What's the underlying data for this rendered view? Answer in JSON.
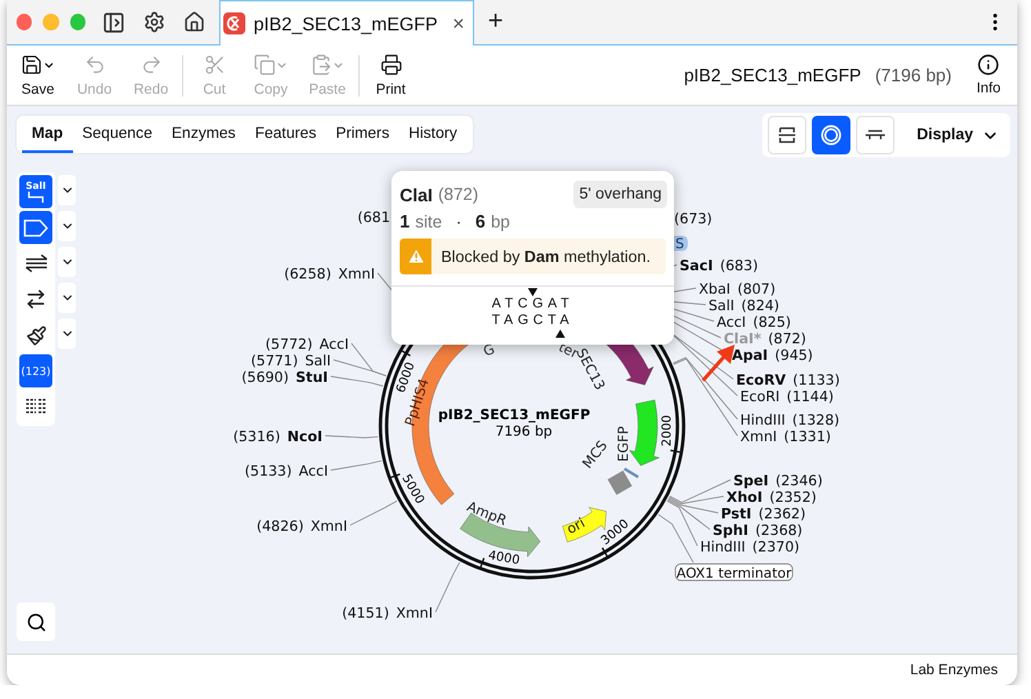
{
  "window": {
    "tab_title": "pIB2_SEC13_mEGFP",
    "close": "×",
    "new_tab": "+"
  },
  "toolbar": {
    "groups": [
      [
        {
          "kind": "save",
          "label": "Save",
          "disabled": false,
          "menu": true
        },
        {
          "kind": "undo",
          "label": "Undo",
          "disabled": true,
          "menu": false
        },
        {
          "kind": "redo",
          "label": "Redo",
          "disabled": true,
          "menu": false
        }
      ],
      [
        {
          "kind": "cut",
          "label": "Cut",
          "disabled": true,
          "menu": false
        },
        {
          "kind": "copy",
          "label": "Copy",
          "disabled": true,
          "menu": true
        },
        {
          "kind": "paste",
          "label": "Paste",
          "disabled": true,
          "menu": true
        }
      ],
      [
        {
          "kind": "print",
          "label": "Print",
          "disabled": false,
          "menu": false
        }
      ]
    ],
    "document": {
      "name": "pIB2_SEC13_mEGFP",
      "size": "(7196 bp)"
    },
    "info": "Info"
  },
  "view_tabs": [
    {
      "label": "Map",
      "selected": true
    },
    {
      "label": "Sequence",
      "selected": false
    },
    {
      "label": "Enzymes",
      "selected": false
    },
    {
      "label": "Features",
      "selected": false
    },
    {
      "label": "Primers",
      "selected": false
    },
    {
      "label": "History",
      "selected": false
    }
  ],
  "display": {
    "views": [
      {
        "kind": "linear",
        "selected": false
      },
      {
        "kind": "circular",
        "selected": true
      },
      {
        "kind": "sequence",
        "selected": false
      }
    ],
    "label": "Display"
  },
  "tools": [
    {
      "kind": "sites",
      "text": "SalI",
      "selected": true,
      "dropdown": true
    },
    {
      "kind": "features",
      "selected": true,
      "dropdown": true
    },
    {
      "kind": "strands",
      "selected": false,
      "dropdown": true
    },
    {
      "kind": "directions",
      "selected": false,
      "dropdown": true
    },
    {
      "kind": "colors",
      "selected": false,
      "dropdown": true
    },
    {
      "kind": "numbers",
      "text": "(123)",
      "selected": true,
      "dropdown": false
    },
    {
      "kind": "list",
      "selected": false,
      "dropdown": false
    }
  ],
  "map": {
    "name": "pIB2_SEC13_mEGFP",
    "length": "7196 bp",
    "ticks": [
      "2000",
      "3000",
      "4000",
      "5000",
      "6000"
    ],
    "features": [
      {
        "label": "PpHIS4",
        "color": "#f5813f"
      },
      {
        "label": "SEC13",
        "color": "#8c2b6c"
      },
      {
        "label": "EGFP",
        "color": "#22e622"
      },
      {
        "label": "MCS",
        "color": "#8c8c8c"
      },
      {
        "label": "ori",
        "color": "#ffff1a"
      },
      {
        "label": "AmpR",
        "color": "#93bf8c"
      }
    ],
    "promoter_fragments": [
      "G",
      "ter"
    ],
    "tags": [
      "S",
      "AOX1 terminator"
    ],
    "left_sites": [
      {
        "position": "(681"
      },
      {
        "position": "(6258)",
        "name": "XmnI",
        "unique": false
      },
      {
        "position": "(5772)",
        "name": "AccI",
        "unique": false
      },
      {
        "position": "(5771)",
        "name": "SalI",
        "unique": false
      },
      {
        "position": "(5690)",
        "name": "StuI",
        "unique": true
      },
      {
        "position": "(5316)",
        "name": "NcoI",
        "unique": true
      },
      {
        "position": "(5133)",
        "name": "AccI",
        "unique": false
      },
      {
        "position": "(4826)",
        "name": "XmnI",
        "unique": false
      },
      {
        "position": "(4151)",
        "name": "XmnI",
        "unique": false
      }
    ],
    "right_sites": [
      {
        "position": "(673)"
      },
      {
        "name": "SacI",
        "position": "(683)",
        "unique": true,
        "blocked": false
      },
      {
        "name": "XbaI",
        "position": "(807)",
        "unique": false,
        "blocked": false
      },
      {
        "name": "SalI",
        "position": "(824)",
        "unique": false,
        "blocked": false
      },
      {
        "name": "AccI",
        "position": "(825)",
        "unique": false,
        "blocked": false
      },
      {
        "name": "ClaI*",
        "position": "(872)",
        "unique": false,
        "blocked": true
      },
      {
        "name": "ApaI",
        "position": "(945)",
        "unique": true,
        "blocked": false
      },
      {
        "name": "EcoRV",
        "position": "(1133)",
        "unique": true,
        "blocked": false
      },
      {
        "name": "EcoRI",
        "position": "(1144)",
        "unique": false,
        "blocked": false
      },
      {
        "name": "HindIII",
        "position": "(1328)",
        "unique": false,
        "blocked": false
      },
      {
        "name": "XmnI",
        "position": "(1331)",
        "unique": false,
        "blocked": false
      },
      {
        "name": "SpeI",
        "position": "(2346)",
        "unique": true,
        "blocked": false
      },
      {
        "name": "XhoI",
        "position": "(2352)",
        "unique": true,
        "blocked": false
      },
      {
        "name": "PstI",
        "position": "(2362)",
        "unique": true,
        "blocked": false
      },
      {
        "name": "SphI",
        "position": "(2368)",
        "unique": true,
        "blocked": false
      },
      {
        "name": "HindIII",
        "position": "(2370)",
        "unique": false,
        "blocked": false
      }
    ]
  },
  "popup": {
    "enzyme": "ClaI",
    "position": "(872)",
    "overhang": "5' overhang",
    "sites": "1",
    "sites_unit": "site",
    "separator": "·",
    "length": "6",
    "length_unit": "bp",
    "warning": "Blocked by **Dam** methylation.",
    "top_strand": "ATCGAT",
    "bottom_strand": "TAGCTA"
  },
  "status_bar": "Lab Enzymes"
}
